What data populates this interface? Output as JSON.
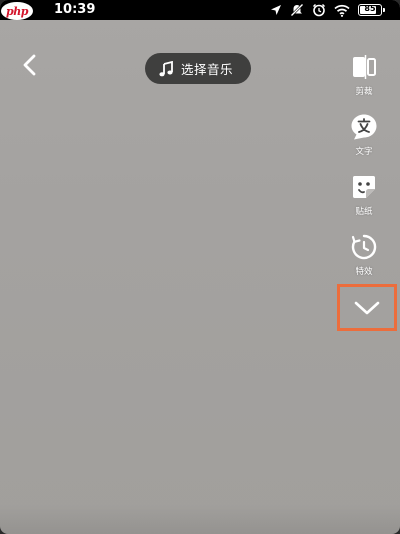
{
  "status_bar": {
    "logo_text": "php",
    "time": "10:39",
    "battery": "85",
    "icons": [
      "location-arrow-icon",
      "mute-icon",
      "alarm-icon",
      "wifi-icon",
      "battery-icon"
    ]
  },
  "header": {
    "back_icon": "chevron-left-icon",
    "music_button_icon": "music-note-icon",
    "music_button_label": "选择音乐"
  },
  "toolbar": {
    "items": [
      {
        "icon": "crop-icon",
        "label": "剪裁"
      },
      {
        "icon": "text-icon",
        "label": "文字"
      },
      {
        "icon": "sticker-icon",
        "label": "贴纸"
      },
      {
        "icon": "effects-icon",
        "label": "特效"
      }
    ],
    "expand_icon": "chevron-down-icon"
  },
  "colors": {
    "highlight_border": "#ec6d3c",
    "background": "#a4a2a0",
    "pill_background": "#282828"
  }
}
